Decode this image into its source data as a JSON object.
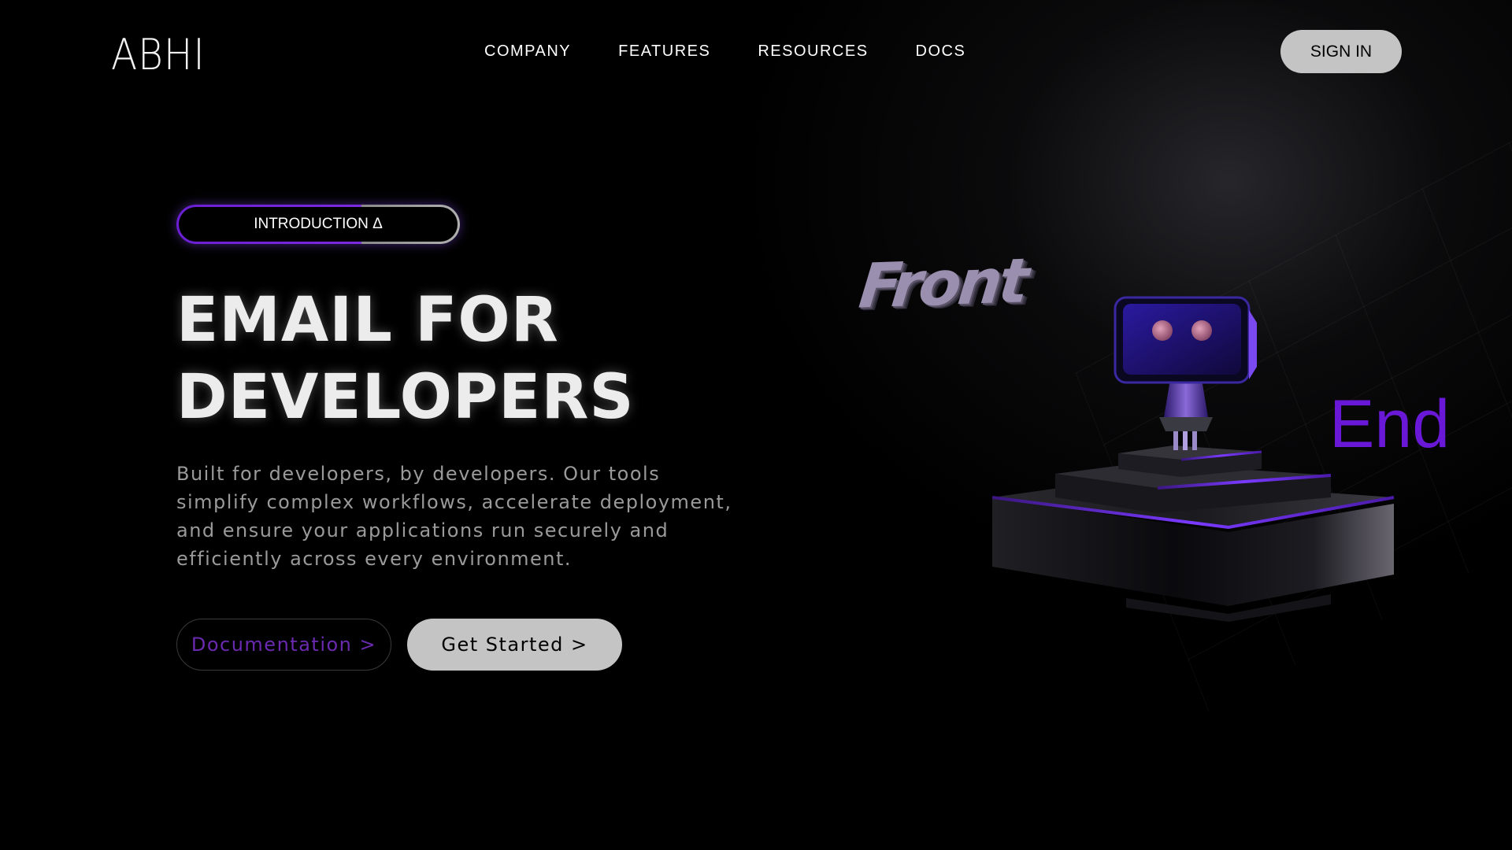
{
  "header": {
    "logo": "ABHI",
    "nav": [
      "COMPANY",
      "FEATURES",
      "RESOURCES",
      "DOCS"
    ],
    "signin_label": "SIGN IN"
  },
  "hero": {
    "badge": "INTRODUCTION Δ",
    "title_line1": "EMAIL FOR",
    "title_line2": "DEVELOPERS",
    "description": "Built for developers, by developers. Our tools simplify complex workflows, accelerate deployment, and ensure your applications run securely and efficiently across every environment.",
    "docs_button": "Documentation >",
    "start_button": "Get Started >"
  },
  "illustration": {
    "front_label": "Front",
    "end_label": "End"
  },
  "colors": {
    "accent": "#6a18d8",
    "background": "#000000",
    "button_gray": "#c4c4c4"
  }
}
